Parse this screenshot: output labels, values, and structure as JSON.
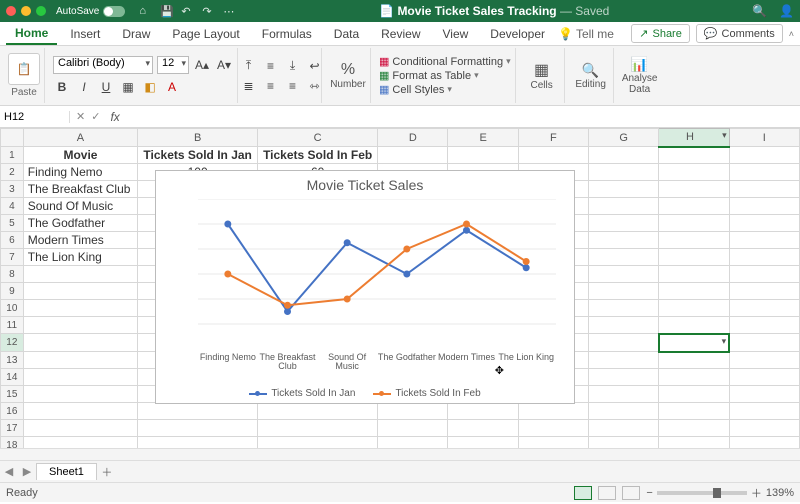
{
  "titlebar": {
    "autosave": "AutoSave",
    "doc_icon": "📄",
    "filename": "Movie Ticket Sales Tracking",
    "saved": "— Saved"
  },
  "ribbon_tabs": [
    "Home",
    "Insert",
    "Draw",
    "Page Layout",
    "Formulas",
    "Data",
    "Review",
    "View",
    "Developer"
  ],
  "tellme": "Tell me",
  "share": "Share",
  "comments": "Comments",
  "toolbar": {
    "paste": "Paste",
    "font_name": "Calibri (Body)",
    "font_size": "12",
    "number": "Number",
    "cf": "Conditional Formatting",
    "fat": "Format as Table",
    "cs": "Cell Styles",
    "cells": "Cells",
    "editing": "Editing",
    "analyse": "Analyse\nData"
  },
  "namebox": {
    "ref": "H12"
  },
  "cols": [
    "",
    "A",
    "B",
    "C",
    "D",
    "E",
    "F",
    "G",
    "H",
    "I"
  ],
  "rows": [
    {
      "n": "1",
      "a": "Movie",
      "b": "Tickets Sold In Jan",
      "c": "Tickets Sold In Feb",
      "bold": true
    },
    {
      "n": "2",
      "a": "Finding Nemo",
      "b": "100",
      "c": "60"
    },
    {
      "n": "3",
      "a": "The Breakfast Club",
      "b": "30",
      "c": "35"
    },
    {
      "n": "4",
      "a": "Sound Of Music",
      "b": "",
      "c": ""
    },
    {
      "n": "5",
      "a": "The Godfather",
      "b": "",
      "c": ""
    },
    {
      "n": "6",
      "a": "Modern Times",
      "b": "",
      "c": ""
    },
    {
      "n": "7",
      "a": "The Lion King",
      "b": "",
      "c": ""
    }
  ],
  "chart_data": {
    "type": "line",
    "title": "Movie Ticket Sales",
    "categories": [
      "Finding Nemo",
      "The Breakfast Club",
      "Sound Of Music",
      "The Godfather",
      "Modern Times",
      "The Lion King"
    ],
    "series": [
      {
        "name": "Tickets Sold In Jan",
        "values": [
          100,
          30,
          85,
          60,
          95,
          65
        ],
        "color": "#4472c4"
      },
      {
        "name": "Tickets Sold In Feb",
        "values": [
          60,
          35,
          40,
          80,
          100,
          70
        ],
        "color": "#ed7d31"
      }
    ],
    "ylim": [
      0,
      120
    ],
    "yticks": [
      20,
      40,
      60,
      80,
      100,
      120
    ]
  },
  "sheet_tab": "Sheet1",
  "status": {
    "ready": "Ready",
    "zoom": "139%"
  }
}
